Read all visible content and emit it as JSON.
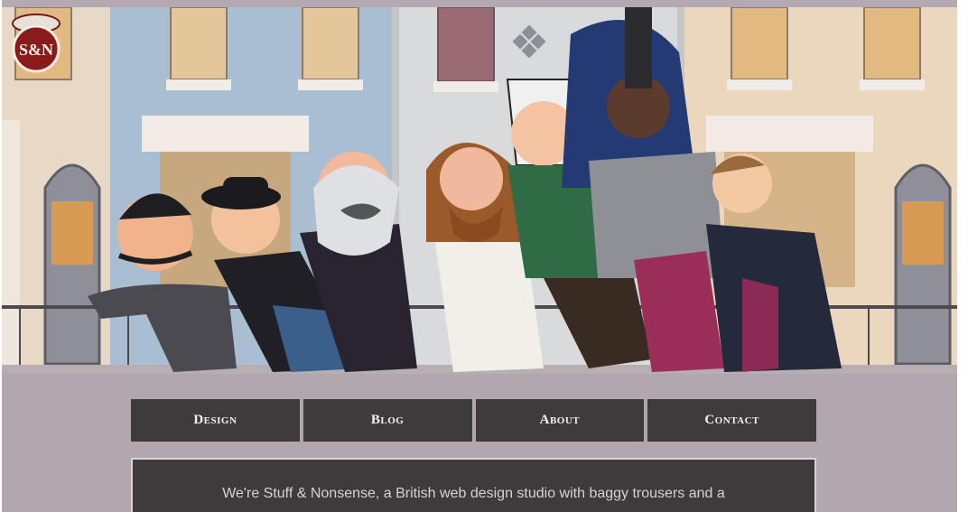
{
  "site": {
    "logo_text": "S&N",
    "nav": [
      {
        "label": "Design"
      },
      {
        "label": "Blog"
      },
      {
        "label": "About"
      },
      {
        "label": "Contact"
      }
    ],
    "intro_text": "We're Stuff & Nonsense, a British web design studio with baggy trousers and a"
  },
  "colors": {
    "nav_bg": "#3d3b3c",
    "nav_text": "#f3f1f2",
    "ground": "#b2a7ae",
    "logo_red": "#8b1a1a"
  },
  "illustration": {
    "characters": [
      "moustache-villain-icon",
      "bowler-hat-man-icon",
      "bearded-professor-icon",
      "long-haired-bearded-man-icon",
      "bandaged-man-icon",
      "ape-helmet-icon",
      "nervous-man-icon"
    ]
  }
}
